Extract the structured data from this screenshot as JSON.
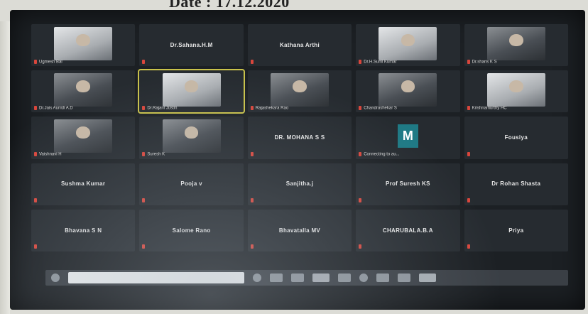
{
  "caption": "Date : 17.12.2020",
  "participants": [
    {
      "name": "Ugmesh Bal",
      "type": "video"
    },
    {
      "name": "Dr.Sahana.H.M",
      "type": "name"
    },
    {
      "name": "Kathana Arthi",
      "type": "name"
    },
    {
      "name": "Dr.H.Sunil Kumar",
      "type": "video"
    },
    {
      "name": "Dr.sharis K S",
      "type": "video"
    },
    {
      "name": "Dr.Jais Aunidi A.D",
      "type": "video"
    },
    {
      "name": "Dr.Rajani Justin",
      "type": "video",
      "active": true
    },
    {
      "name": "Rajashekara Rao",
      "type": "video"
    },
    {
      "name": "Chandrashekar S",
      "type": "video"
    },
    {
      "name": "Krishnamurthy HC",
      "type": "video"
    },
    {
      "name": "Vaishnavi H",
      "type": "video"
    },
    {
      "name": "Suresh K",
      "type": "video"
    },
    {
      "name": "DR. MOHANA S S",
      "type": "name"
    },
    {
      "name": "Connecting to au...",
      "type": "avatar",
      "initial": "M"
    },
    {
      "name": "Fousiya",
      "type": "name"
    },
    {
      "name": "Sushma Kumar",
      "type": "name"
    },
    {
      "name": "Pooja v",
      "type": "name"
    },
    {
      "name": "Sanjitha.j",
      "type": "name"
    },
    {
      "name": "Prof Suresh KS",
      "type": "name"
    },
    {
      "name": "Dr Rohan Shasta",
      "type": "name"
    },
    {
      "name": "Bhavana S N",
      "type": "name"
    },
    {
      "name": "Salome Rano",
      "type": "name"
    },
    {
      "name": "Bhavatalla MV",
      "type": "name"
    },
    {
      "name": "CHARUBALA.B.A",
      "type": "name"
    },
    {
      "name": "Priya",
      "type": "name"
    }
  ],
  "toolbar": {
    "tools": [
      "mute-icon",
      "video-icon",
      "security-icon",
      "participants-icon",
      "chat-icon",
      "share-icon",
      "record-icon",
      "reactions-icon",
      "leave-icon"
    ]
  }
}
